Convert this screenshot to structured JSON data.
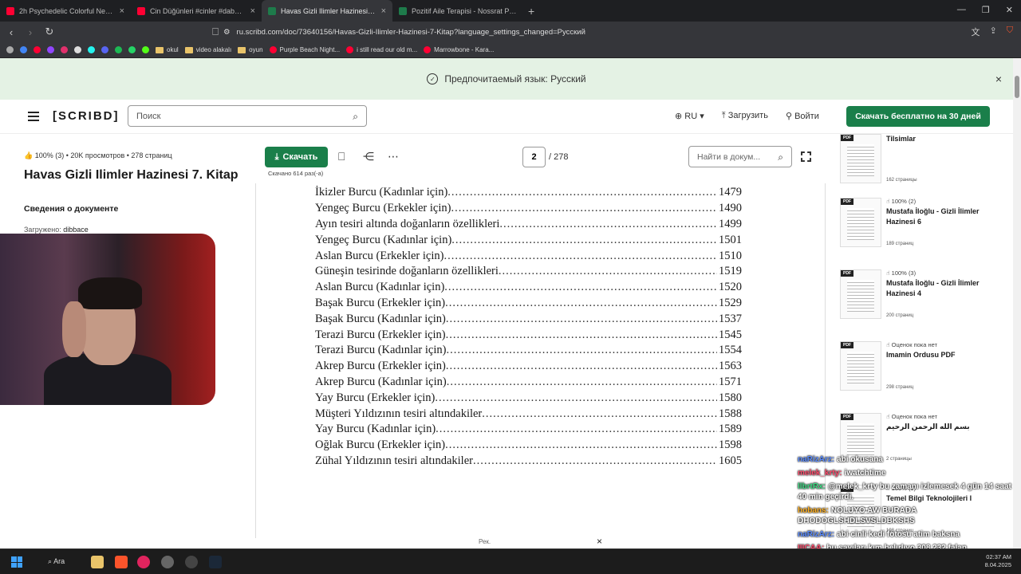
{
  "browser": {
    "tabs": [
      {
        "title": "2h Psychedelic Colorful Neon Backgr",
        "color": "#ff0033"
      },
      {
        "title": "Cin Düğünleri #cinler #dabbe #korku",
        "color": "#ff0033"
      },
      {
        "title": "Havas Gizli Ilimler Hazinesi 7. Kita",
        "color": "#1e7b4b",
        "active": true
      },
      {
        "title": "Pozitif Aile Terapisi - Nossrat Pesesch",
        "color": "#1e7b4b"
      }
    ],
    "new_tab": "+",
    "url": "ru.scribd.com/doc/73640156/Havas-Gizli-Ilimler-Hazinesi-7-Kitap?language_settings_changed=Русский",
    "bookmarks": [
      "okul",
      "video alakalı",
      "oyun",
      "Purple Beach Night...",
      "i still read our old m...",
      "Marrowbone - Kara..."
    ]
  },
  "banner": {
    "text": "Предпочитаемый язык: Русский",
    "close": "×"
  },
  "header": {
    "logo": "[SCRIBD]",
    "search_placeholder": "Поиск",
    "lang": "RU",
    "upload": "Загрузить",
    "login": "Войти",
    "cta": "Скачать бесплатно на 30 дней"
  },
  "document": {
    "rating": "100% (3)",
    "views": "20K просмотров",
    "pages": "278 страниц",
    "title": "Havas Gizli Ilimler Hazinesi 7. Kitap",
    "about": "Сведения о документе",
    "uploaded_label": "Загружено:",
    "uploader": "dibbace"
  },
  "toolbar": {
    "download": "Скачать",
    "downloaded": "Скачано 614 раз(-а)",
    "page_current": "2",
    "page_total": "/ 278",
    "find_placeholder": "Найти в докум..."
  },
  "toc": [
    {
      "title": "İkizler Burcu (Kadınlar için)",
      "page": "1479"
    },
    {
      "title": "Yengeç Burcu (Erkekler için)",
      "page": "1490"
    },
    {
      "title": "Ayın tesiri altında doğanların özellikleri",
      "page": "1499"
    },
    {
      "title": "Yengeç Burcu (Kadınlar için)",
      "page": "1501"
    },
    {
      "title": "Aslan Burcu (Erkekler için)",
      "page": "1510"
    },
    {
      "title": "Güneşin tesirinde doğanların özellikleri",
      "page": "1519"
    },
    {
      "title": "Aslan Burcu (Kadınlar için)",
      "page": "1520"
    },
    {
      "title": "Başak Burcu (Erkekler için)",
      "page": "1529"
    },
    {
      "title": "Başak Burcu (Kadınlar için)",
      "page": "1537"
    },
    {
      "title": "Terazi Burcu (Erkekler için)",
      "page": "1545"
    },
    {
      "title": "Terazi Burcu (Kadınlar için)",
      "page": "1554"
    },
    {
      "title": "Akrep Burcu (Erkekler için)",
      "page": "1563"
    },
    {
      "title": "Akrep Burcu (Kadınlar için)",
      "page": "1571"
    },
    {
      "title": "Yay Burcu (Erkekler için)",
      "page": "1580"
    },
    {
      "title": "Müşteri Yıldızının tesiri altındakiler",
      "page": "1588"
    },
    {
      "title": "Yay Burcu (Kadınlar için)",
      "page": "1589"
    },
    {
      "title": "Oğlak Burcu (Erkekler için)",
      "page": "1598"
    },
    {
      "title": "Zühal Yıldızının tesiri altındakiler",
      "page": "1605"
    }
  ],
  "overlay": {
    "rec": "Рек.",
    "close": "×"
  },
  "related": [
    {
      "rating": "",
      "title": "Tilsimlar",
      "pages": "162 страницы"
    },
    {
      "rating": "100% (2)",
      "title": "Mustafa İloğlu - Gizli İlimler Hazinesi 6",
      "pages": "189 страниц"
    },
    {
      "rating": "100% (3)",
      "title": "Mustafa İloğlu - Gizli İlimler Hazinesi 4",
      "pages": "200 страниц"
    },
    {
      "rating": "Оценок пока нет",
      "title": "Imamin Ordusu PDF",
      "pages": "298 страниц"
    },
    {
      "rating": "Оценок пока нет",
      "title": "بسم الله الرحمن الرحيم",
      "pages": "2 страницы"
    },
    {
      "rating": "100% (1)",
      "title": "Temel Bilgi Teknolojileri I",
      "pages": "198 страниц"
    }
  ],
  "chat": [
    {
      "user": "naRizArz:",
      "msg": "abi okusana",
      "color": "#5b8cff"
    },
    {
      "user": "melek_krty:",
      "msg": "iwatchtime",
      "color": "#ff4d6d"
    },
    {
      "user": "llbrtRx:",
      "msg": "@melek_krty bu zamanı izlemesek 4 gün 14 saat 40 min geçirdi.",
      "color": "#3ddc84"
    },
    {
      "user": "hobans:",
      "msg": "NOLUYO AW BURADA DHODOGLSHDLSVSLDBKSHS",
      "color": "#ffb020"
    },
    {
      "user": "naRizArz:",
      "msg": "abi cinli kedi fotosu atim baksna",
      "color": "#5b8cff"
    },
    {
      "user": "IIICAA:",
      "msg": "bu sayıları kım belırlıyo 308 232 falan",
      "color": "#ff4d6d"
    }
  ],
  "taskbar": {
    "search": "Ara",
    "time": "02:37 AM",
    "date": "8.04.2025"
  }
}
